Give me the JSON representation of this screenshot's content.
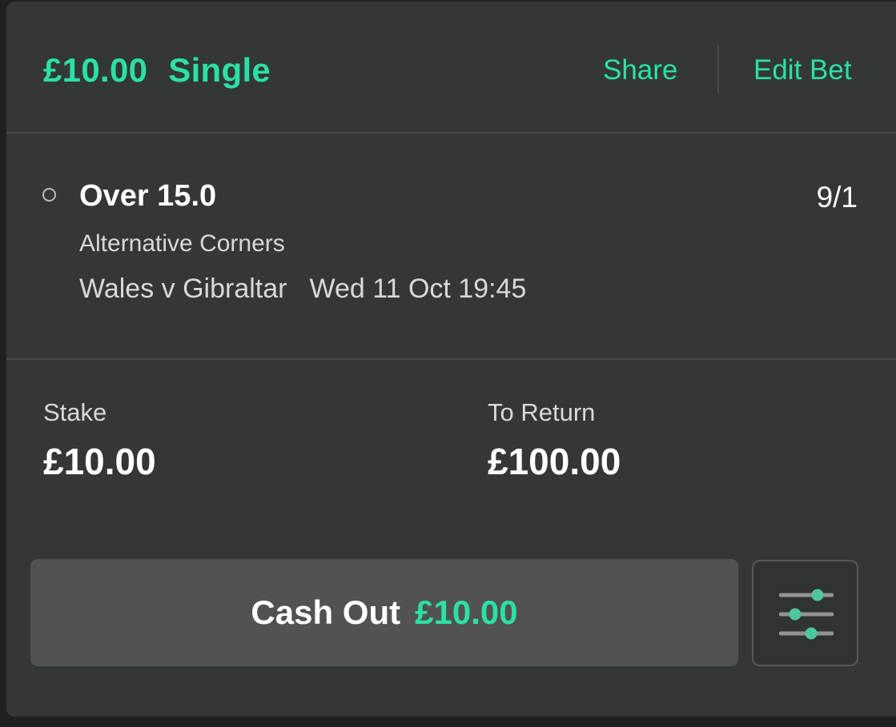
{
  "header": {
    "stake": "£10.00",
    "bet_type": "Single",
    "share_label": "Share",
    "edit_label": "Edit Bet"
  },
  "selection": {
    "name": "Over 15.0",
    "odds": "9/1",
    "market": "Alternative Corners",
    "event": "Wales v Gibraltar",
    "datetime": "Wed 11 Oct 19:45"
  },
  "summary": {
    "stake_label": "Stake",
    "stake_value": "£10.00",
    "return_label": "To Return",
    "return_value": "£100.00"
  },
  "cashout": {
    "label": "Cash Out",
    "amount": "£10.00"
  },
  "colors": {
    "accent": "#2be0a6",
    "card_bg": "#333736",
    "button_bg": "#525252"
  },
  "icons": {
    "status": "circle-outline-icon",
    "settings": "sliders-icon"
  }
}
